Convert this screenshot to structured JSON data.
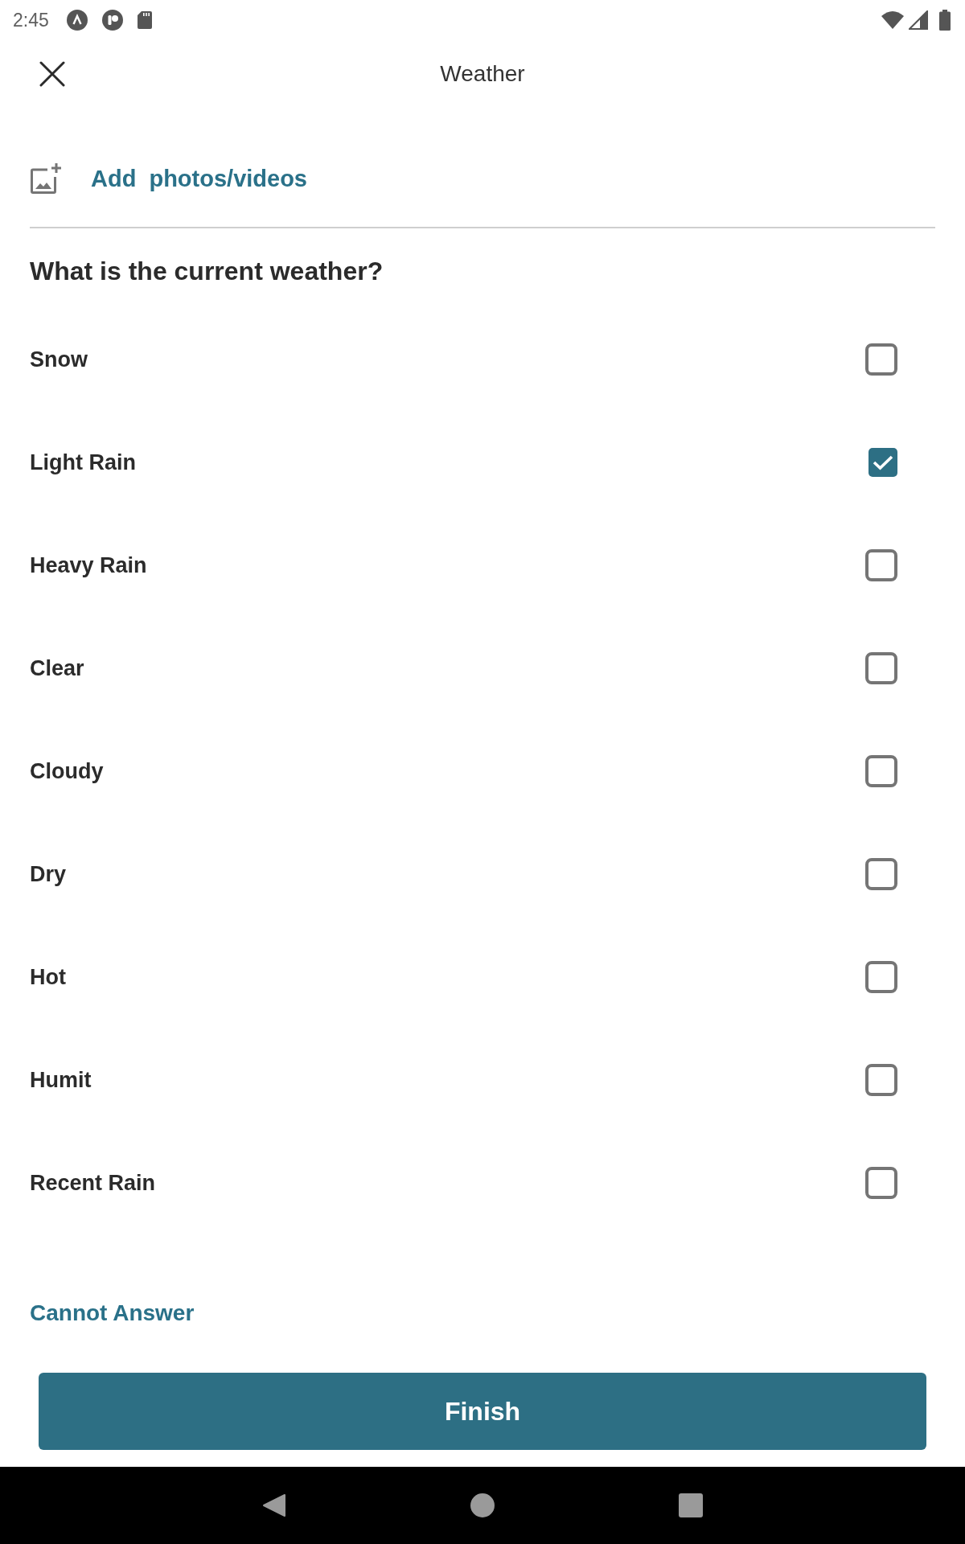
{
  "status_bar": {
    "time": "2:45"
  },
  "header": {
    "title": "Weather"
  },
  "attachments": {
    "label": "Add photos/videos"
  },
  "question": {
    "text": "What is the current weather?",
    "options": [
      {
        "label": "Snow",
        "checked": false
      },
      {
        "label": "Light Rain",
        "checked": true
      },
      {
        "label": "Heavy Rain",
        "checked": false
      },
      {
        "label": "Clear",
        "checked": false
      },
      {
        "label": "Cloudy",
        "checked": false
      },
      {
        "label": "Dry",
        "checked": false
      },
      {
        "label": "Hot",
        "checked": false
      },
      {
        "label": "Humit",
        "checked": false
      },
      {
        "label": "Recent Rain",
        "checked": false
      }
    ]
  },
  "cannot_answer": {
    "label": "Cannot Answer"
  },
  "finish_button": {
    "label": "Finish"
  }
}
